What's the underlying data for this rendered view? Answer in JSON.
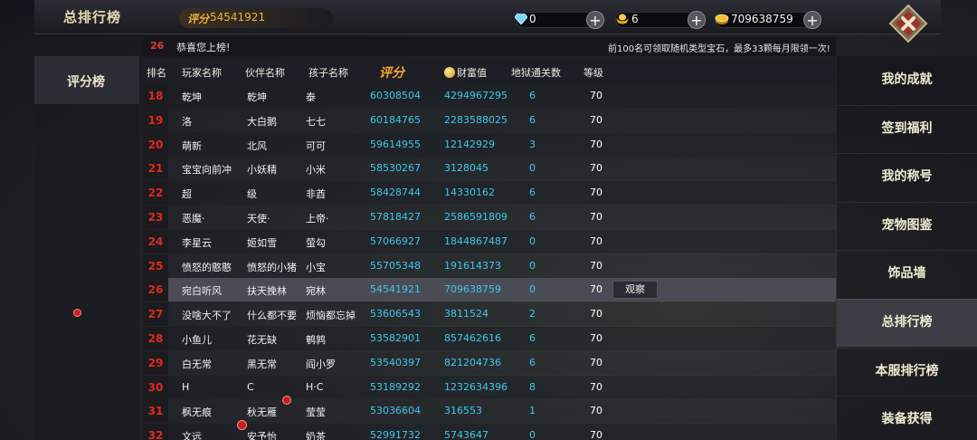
{
  "header": {
    "title": "总排行榜",
    "score_tag": "评分",
    "score_value": "54541921",
    "diamond": "0",
    "ingot": "6",
    "gold": "709638759",
    "plus_symbol": "+"
  },
  "notice": {
    "my_rank": "26",
    "congrats": "恭喜您上榜!",
    "tip": "前100名可领取随机类型宝石，最多33颗每月限领一次!"
  },
  "left_tab": {
    "label": "评分榜"
  },
  "columns": {
    "rank": "排名",
    "player": "玩家名称",
    "partner": "伙伴名称",
    "child": "孩子名称",
    "score": "评分",
    "wealth": "财富值",
    "hell": "地狱通关数",
    "level": "等级"
  },
  "rows": [
    {
      "rank": "18",
      "player": "乾坤",
      "partner": "乾坤",
      "child": "泰",
      "score": "60308504",
      "wealth": "4294967295",
      "hell": "6",
      "level": "70"
    },
    {
      "rank": "19",
      "player": "洛",
      "partner": "大白鹅",
      "child": "七七",
      "score": "60184765",
      "wealth": "2283588025",
      "hell": "6",
      "level": "70"
    },
    {
      "rank": "20",
      "player": "萌新",
      "partner": "北风",
      "child": "可可",
      "score": "59614955",
      "wealth": "12142929",
      "hell": "3",
      "level": "70"
    },
    {
      "rank": "21",
      "player": "宝宝向前冲",
      "partner": "小妖精",
      "child": "小米",
      "score": "58530267",
      "wealth": "3128045",
      "hell": "0",
      "level": "70"
    },
    {
      "rank": "22",
      "player": "超",
      "partner": "级",
      "child": "非酋",
      "score": "58428744",
      "wealth": "14330162",
      "hell": "6",
      "level": "70"
    },
    {
      "rank": "23",
      "player": "恶魔·",
      "partner": "天使·",
      "child": "上帝·",
      "score": "57818427",
      "wealth": "2586591809",
      "hell": "6",
      "level": "70"
    },
    {
      "rank": "24",
      "player": "李星云",
      "partner": "姬如雪",
      "child": "萤勾",
      "score": "57066927",
      "wealth": "1844867487",
      "hell": "0",
      "level": "70"
    },
    {
      "rank": "25",
      "player": "愤怒的憨憨",
      "partner": "愤怒的小猪",
      "child": "小宝",
      "score": "55705348",
      "wealth": "191614373",
      "hell": "0",
      "level": "70"
    },
    {
      "rank": "26",
      "player": "宛白听风",
      "partner": "扶天挽林",
      "child": "宛林",
      "score": "54541921",
      "wealth": "709638759",
      "hell": "0",
      "level": "70"
    },
    {
      "rank": "27",
      "player": "没啥大不了",
      "partner": "什么都不要",
      "child": "烦恼都忘掉",
      "score": "53606543",
      "wealth": "3811524",
      "hell": "2",
      "level": "70"
    },
    {
      "rank": "28",
      "player": "小鱼儿",
      "partner": "花无缺",
      "child": "鹌鹑",
      "score": "53582901",
      "wealth": "857462616",
      "hell": "6",
      "level": "70"
    },
    {
      "rank": "29",
      "player": "白无常",
      "partner": "黑无常",
      "child": "阎小罗",
      "score": "53540397",
      "wealth": "821204736",
      "hell": "6",
      "level": "70"
    },
    {
      "rank": "30",
      "player": "H",
      "partner": "C",
      "child": "H·C",
      "score": "53189292",
      "wealth": "1232634396",
      "hell": "8",
      "level": "70"
    },
    {
      "rank": "31",
      "player": "枫无痕",
      "partner": "秋无雁",
      "child": "莹莹",
      "score": "53036604",
      "wealth": "316553",
      "hell": "1",
      "level": "70"
    },
    {
      "rank": "32",
      "player": "文远",
      "partner": "安予怡",
      "child": "奶茶",
      "score": "52991732",
      "wealth": "5743647",
      "hell": "0",
      "level": "70"
    }
  ],
  "view_button": "观察",
  "side_menu": [
    {
      "label": "我的成就",
      "active": false
    },
    {
      "label": "签到福利",
      "active": false
    },
    {
      "label": "我的称号",
      "active": false
    },
    {
      "label": "宠物图鉴",
      "active": false
    },
    {
      "label": "饰品墙",
      "active": false
    },
    {
      "label": "总排行榜",
      "active": true
    },
    {
      "label": "本服排行榜",
      "active": false
    },
    {
      "label": "装备获得",
      "active": false
    }
  ],
  "colors": {
    "rank_red": "#e2281e",
    "value_blue": "#3ec8f0",
    "score_orange": "#f2a531",
    "title_cream": "#e8d9b0"
  },
  "icons": [
    "diamond-icon",
    "ingot-icon",
    "gold-coin-icon",
    "plus-icon",
    "close-icon",
    "coin-icon"
  ]
}
